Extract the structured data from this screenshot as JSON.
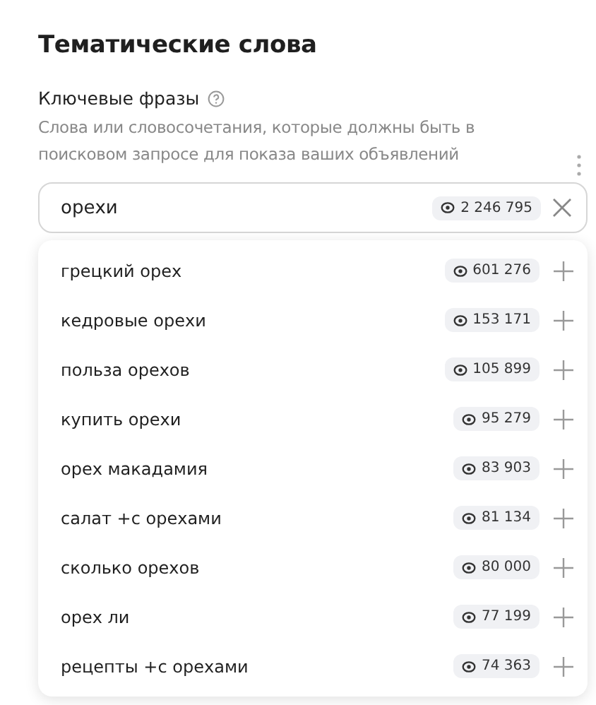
{
  "title": "Тематические слова",
  "field_label": "Ключевые фразы",
  "description": "Слова или словосочетания, которые должны быть в поисковом запросе для показа ваших объявлений",
  "search": {
    "value": "орехи",
    "impressions": "2 246 795"
  },
  "suggestions": [
    {
      "phrase": "грецкий орех",
      "impressions": "601 276"
    },
    {
      "phrase": "кедровые орехи",
      "impressions": "153 171"
    },
    {
      "phrase": "польза орехов",
      "impressions": "105 899"
    },
    {
      "phrase": "купить орехи",
      "impressions": "95 279"
    },
    {
      "phrase": "орех макадамия",
      "impressions": "83 903"
    },
    {
      "phrase": "салат +с орехами",
      "impressions": "81 134"
    },
    {
      "phrase": "сколько орехов",
      "impressions": "80 000"
    },
    {
      "phrase": "орех ли",
      "impressions": "77 199"
    },
    {
      "phrase": "рецепты +с орехами",
      "impressions": "74 363"
    }
  ]
}
